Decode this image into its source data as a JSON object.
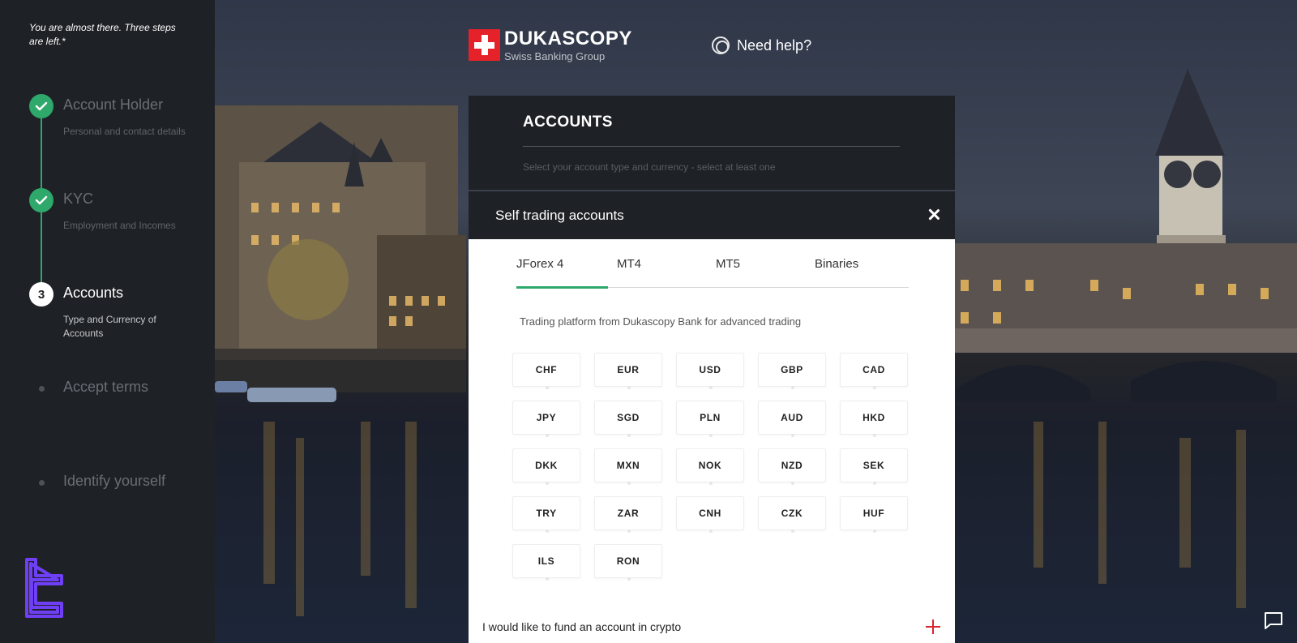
{
  "sidebar": {
    "note": "You are almost there. Three steps are left.*",
    "steps": [
      {
        "title": "Account Holder",
        "subtitle": "Personal and contact details",
        "state": "done"
      },
      {
        "title": "KYC",
        "subtitle": "Employment and Incomes",
        "state": "done"
      },
      {
        "number": "3",
        "title": "Accounts",
        "subtitle": "Type and Currency of Accounts",
        "state": "current"
      },
      {
        "title": "Accept terms",
        "state": "pending"
      },
      {
        "title": "Identify yourself",
        "state": "pending"
      }
    ]
  },
  "header": {
    "logo_name": "DUKASCOPY",
    "logo_tagline": "Swiss Banking Group",
    "help_label": "Need help?"
  },
  "accounts_panel": {
    "title": "ACCOUNTS",
    "hint": "Select your account type and currency - select at least one",
    "section_title": "Self trading accounts",
    "tabs": [
      "JForex 4",
      "MT4",
      "MT5",
      "Binaries"
    ],
    "active_tab": "JForex 4",
    "description": "Trading platform from Dukascopy Bank for advanced trading",
    "currencies": [
      "CHF",
      "EUR",
      "USD",
      "GBP",
      "CAD",
      "JPY",
      "SGD",
      "PLN",
      "AUD",
      "HKD",
      "DKK",
      "MXN",
      "NOK",
      "NZD",
      "SEK",
      "TRY",
      "ZAR",
      "CNH",
      "CZK",
      "HUF",
      "ILS",
      "RON"
    ],
    "crypto_label": "I would like to fund an account in crypto"
  },
  "colors": {
    "accent_green": "#2fa86b",
    "brand_red": "#e5222a",
    "sidebar_bg": "#1e2125",
    "brand_purple": "#6f3ff5"
  },
  "icons": [
    "check-icon",
    "help-lifebuoy-icon",
    "close-icon",
    "plus-icon",
    "chat-icon",
    "brand-logo-icon"
  ]
}
